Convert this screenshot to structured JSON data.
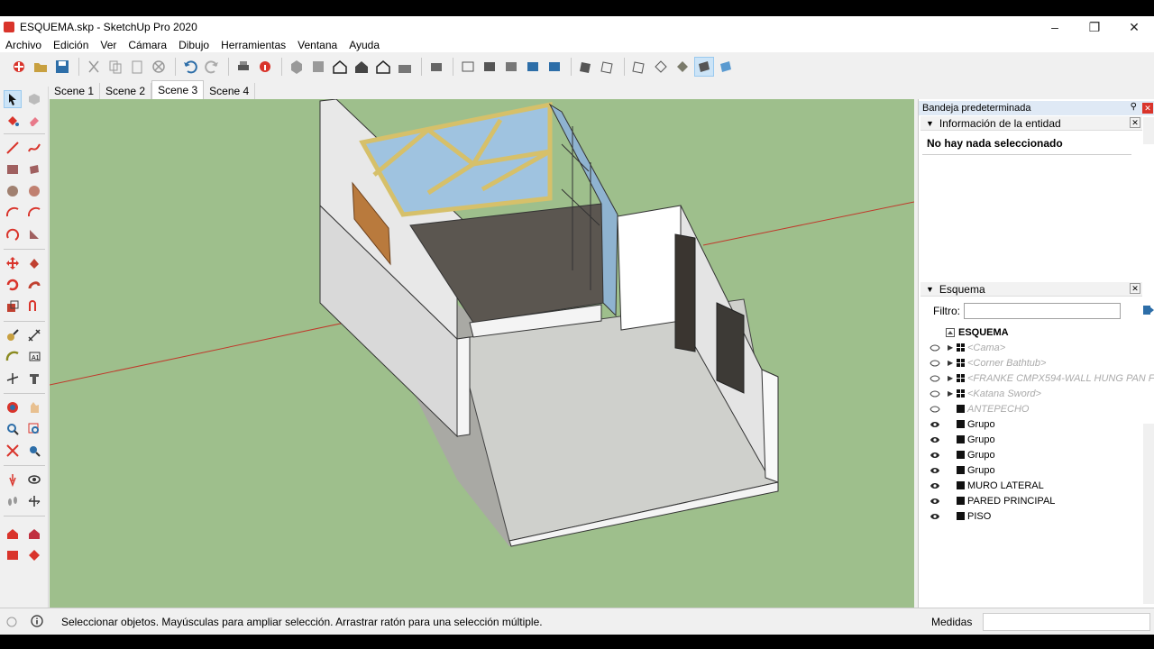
{
  "window": {
    "title": "ESQUEMA.skp - SketchUp Pro 2020"
  },
  "menu": [
    "Archivo",
    "Edición",
    "Ver",
    "Cámara",
    "Dibujo",
    "Herramientas",
    "Ventana",
    "Ayuda"
  ],
  "scenes": {
    "tabs": [
      "Scene 1",
      "Scene 2",
      "Scene 3",
      "Scene 4"
    ],
    "active": "Scene 3"
  },
  "tray": {
    "title": "Bandeja predeterminada",
    "entity_panel": {
      "title": "Información de la entidad",
      "empty_text": "No hay nada seleccionado"
    },
    "outliner": {
      "title": "Esquema",
      "filter_label": "Filtro:",
      "filter_value": "",
      "root": "ESQUEMA",
      "items": [
        {
          "label": "<Cama>",
          "kind": "component",
          "visible": false,
          "expandable": true
        },
        {
          "label": "<Corner Bathtub>",
          "kind": "component",
          "visible": false,
          "expandable": true
        },
        {
          "label": "<FRANKE CMPX594-WALL HUNG PAN FOR",
          "kind": "component",
          "visible": false,
          "expandable": true
        },
        {
          "label": "<Katana Sword>",
          "kind": "component",
          "visible": false,
          "expandable": true
        },
        {
          "label": "ANTEPECHO",
          "kind": "group",
          "visible": false,
          "expandable": false
        },
        {
          "label": "Grupo",
          "kind": "group",
          "visible": true,
          "expandable": false
        },
        {
          "label": "Grupo",
          "kind": "group",
          "visible": true,
          "expandable": false
        },
        {
          "label": "Grupo",
          "kind": "group",
          "visible": true,
          "expandable": false
        },
        {
          "label": "Grupo",
          "kind": "group",
          "visible": true,
          "expandable": false
        },
        {
          "label": "MURO LATERAL",
          "kind": "group",
          "visible": true,
          "expandable": false
        },
        {
          "label": "PARED PRINCIPAL",
          "kind": "group",
          "visible": true,
          "expandable": false
        },
        {
          "label": "PISO",
          "kind": "group",
          "visible": true,
          "expandable": false
        }
      ]
    }
  },
  "status": {
    "text": "Seleccionar objetos. Mayúsculas para ampliar selección. Arrastrar ratón para una selección múltiple.",
    "measure_label": "Medidas",
    "measure_value": ""
  },
  "colors": {
    "viewport_bg": "#9ebf8c",
    "wall": "#e8e8e8",
    "floor": "#cfd0cc",
    "glass": "#9fc3e0",
    "frame": "#d6c06a",
    "axis_red": "#c0392b"
  }
}
